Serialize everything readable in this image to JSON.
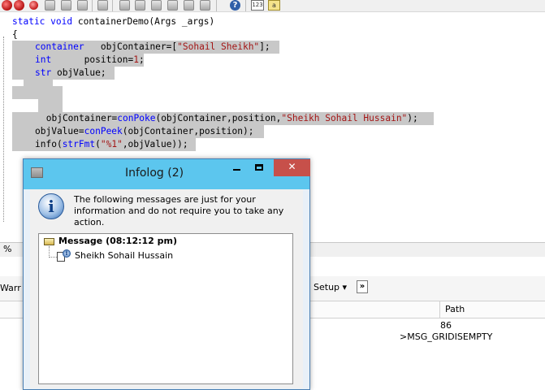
{
  "toolbar": {
    "icons": [
      "stop-icon",
      "pin-icon",
      "save-icon",
      "find-icon",
      "cut-icon",
      "copy-icon",
      "paste-icon",
      "undo-icon",
      "redo-icon",
      "comment-icon",
      "help-icon",
      "line-number-icon",
      "text-format-icon"
    ],
    "line_number_label": "123",
    "text_format_label": "a"
  },
  "code": {
    "signature_kw1": "static",
    "signature_kw2": "void",
    "signature_rest": " containerDemo(Args _args)",
    "open_brace": "{",
    "l1_type": "container",
    "l1_mid": "   objContainer=[",
    "l1_str": "\"Sohail Sheikh\"",
    "l1_end": "];",
    "l2_type": "int",
    "l2_mid": "      position=",
    "l2_num": "1",
    "l2_end": ";",
    "l3_type": "str",
    "l3_rest": " objValue;",
    "l4_a": " objContainer=",
    "l4_fn": "conPoke",
    "l4_b": "(objContainer,position,",
    "l4_str": "\"Sheikh Sohail Hussain\"",
    "l4_end": ");",
    "l5_a": "objValue=",
    "l5_fn": "conPeek",
    "l5_b": "(objContainer,position);",
    "l6_a": "info(",
    "l6_fn": "strFmt",
    "l6_b": "(",
    "l6_str": "\"%1\"",
    "l6_end": ",objValue));"
  },
  "statusbar": {
    "zoom": "%"
  },
  "grid": {
    "warnings_tab": "Warr",
    "setup_label": "Setup ▾",
    "more_button": "»",
    "path_header": "Path",
    "cell_86": "86",
    "cell_msg": ">MSG_GRIDISEMPTY"
  },
  "infolog": {
    "title": "Infolog (2)",
    "message": "The following messages are just for your information and do not require you to take any action.",
    "header": "Message (08:12:12 pm)",
    "item": "Sheikh Sohail Hussain",
    "info_glyph": "i"
  },
  "colors": {
    "keyword": "#0000ff",
    "string": "#a31515",
    "selection": "#c8c8c8",
    "titlebar": "#5cc6ee",
    "close_button": "#c7504a"
  }
}
